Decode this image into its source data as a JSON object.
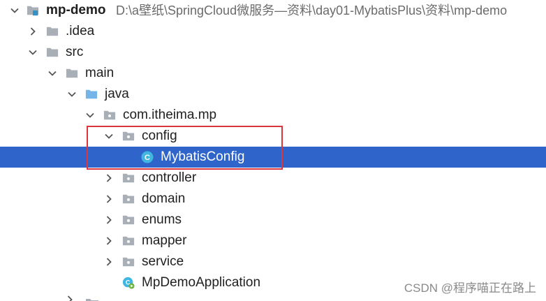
{
  "project_tree": {
    "root": {
      "name": "mp-demo",
      "path": "D:\\a壁纸\\SpringCloud微服务—资料\\day01-MybatisPlus\\资料\\mp-demo",
      "expanded": true,
      "icon": "module-folder-icon"
    },
    "nodes": [
      {
        "label": ".idea",
        "type": "folder",
        "expanded": false,
        "icon": "folder-icon"
      },
      {
        "label": "src",
        "type": "folder",
        "expanded": true,
        "icon": "folder-icon"
      },
      {
        "label": "main",
        "type": "folder",
        "expanded": true,
        "icon": "folder-icon"
      },
      {
        "label": "java",
        "type": "source-root",
        "expanded": true,
        "icon": "source-folder-icon"
      },
      {
        "label": "com.itheima.mp",
        "type": "package",
        "expanded": true,
        "icon": "package-icon"
      },
      {
        "label": "config",
        "type": "package",
        "expanded": true,
        "icon": "package-icon"
      },
      {
        "label": "MybatisConfig",
        "type": "class",
        "selected": true,
        "icon": "class-icon"
      },
      {
        "label": "controller",
        "type": "package",
        "expanded": false,
        "icon": "package-icon"
      },
      {
        "label": "domain",
        "type": "package",
        "expanded": false,
        "icon": "package-icon"
      },
      {
        "label": "enums",
        "type": "package",
        "expanded": false,
        "icon": "package-icon"
      },
      {
        "label": "mapper",
        "type": "package",
        "expanded": false,
        "icon": "package-icon"
      },
      {
        "label": "service",
        "type": "package",
        "expanded": false,
        "icon": "package-icon"
      },
      {
        "label": "MpDemoApplication",
        "type": "spring-boot-class",
        "icon": "spring-boot-class-icon"
      }
    ]
  },
  "annotation": {
    "color": "#d9363e",
    "description": ""
  },
  "watermark": "CSDN @程序喵正在路上",
  "colors": {
    "selection": "#2f65ca",
    "folder": "#a9afb7",
    "source_folder": "#73b5e8",
    "class_icon": "#40b6e0"
  }
}
